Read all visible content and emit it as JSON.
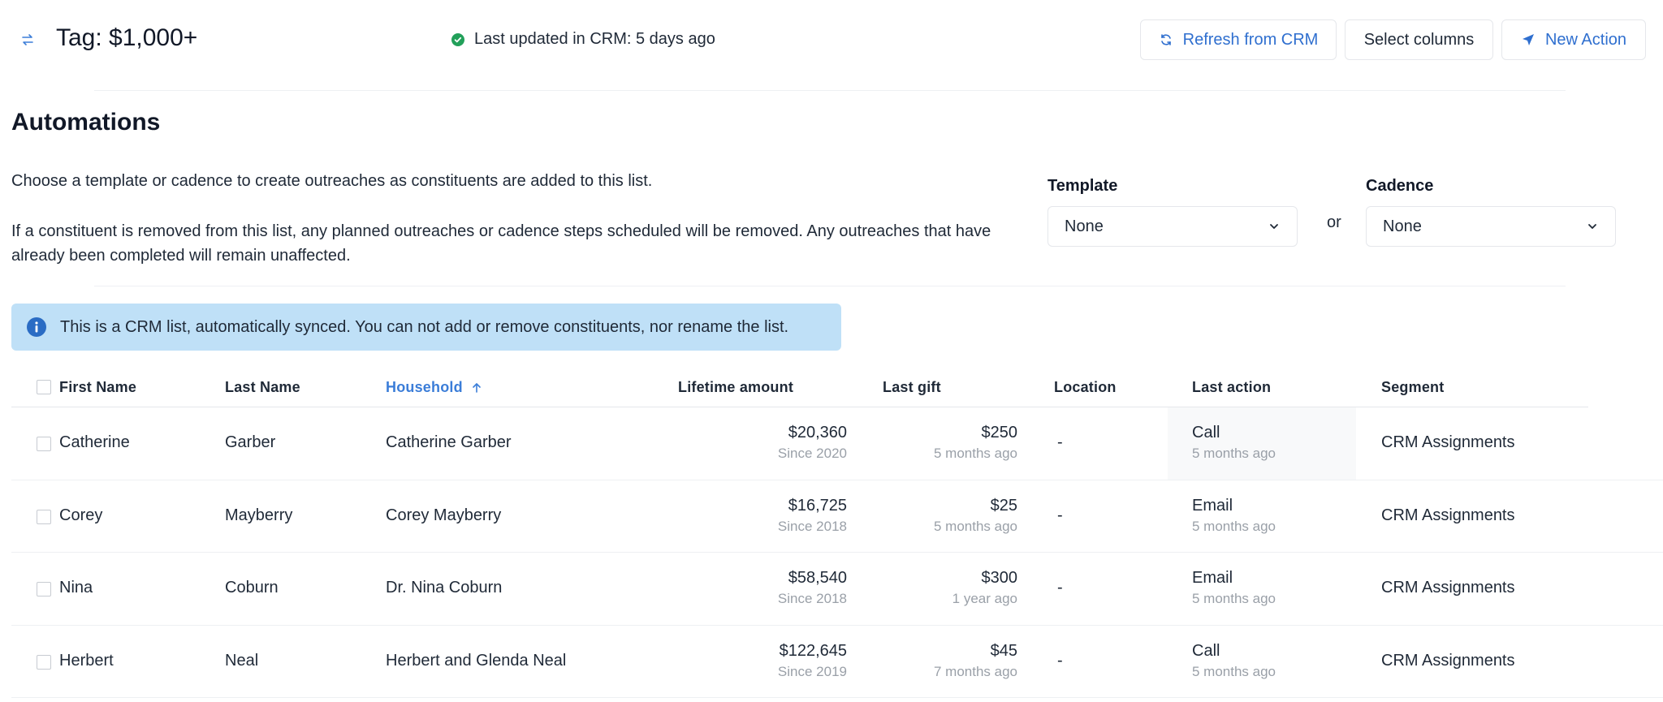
{
  "header": {
    "title": "Tag: $1,000+",
    "updated": "Last updated in CRM: 5 days ago",
    "refresh_label": "Refresh from CRM",
    "select_columns_label": "Select columns",
    "new_action_label": "New Action"
  },
  "automations": {
    "title": "Automations",
    "p1": "Choose a template or cadence to create outreaches as constituents are added to this list.",
    "p2": "If a constituent is removed from this list, any planned outreaches or cadence steps scheduled will be removed. Any outreaches that have already been completed will remain unaffected.",
    "template_label": "Template",
    "template_value": "None",
    "or_label": "or",
    "cadence_label": "Cadence",
    "cadence_value": "None"
  },
  "banner": {
    "text": "This is a CRM list, automatically synced. You can not add or remove constituents, nor rename the list."
  },
  "table": {
    "headers": {
      "first_name": "First Name",
      "last_name": "Last Name",
      "household": "Household",
      "lifetime": "Lifetime amount",
      "last_gift": "Last gift",
      "location": "Location",
      "last_action": "Last action",
      "segment": "Segment"
    },
    "rows": [
      {
        "first": "Catherine",
        "last": "Garber",
        "household": "Catherine Garber",
        "lifetime": "$20,360",
        "since": "Since 2020",
        "gift": "$250",
        "gift_when": "5 months ago",
        "location": "-",
        "action": "Call",
        "action_when": "5 months ago",
        "segment": "CRM Assignments"
      },
      {
        "first": "Corey",
        "last": "Mayberry",
        "household": "Corey Mayberry",
        "lifetime": "$16,725",
        "since": "Since 2018",
        "gift": "$25",
        "gift_when": "5 months ago",
        "location": "-",
        "action": "Email",
        "action_when": "5 months ago",
        "segment": "CRM Assignments"
      },
      {
        "first": "Nina",
        "last": "Coburn",
        "household": "Dr. Nina Coburn",
        "lifetime": "$58,540",
        "since": "Since 2018",
        "gift": "$300",
        "gift_when": "1 year ago",
        "location": "-",
        "action": "Email",
        "action_when": "5 months ago",
        "segment": "CRM Assignments"
      },
      {
        "first": "Herbert",
        "last": "Neal",
        "household": "Herbert and Glenda Neal",
        "lifetime": "$122,645",
        "since": "Since 2019",
        "gift": "$45",
        "gift_when": "7 months ago",
        "location": "-",
        "action": "Call",
        "action_when": "5 months ago",
        "segment": "CRM Assignments"
      }
    ]
  },
  "colors": {
    "accent": "#3b7dd8",
    "banner_bg": "#bfe0f7",
    "status_ok": "#22a05a"
  }
}
